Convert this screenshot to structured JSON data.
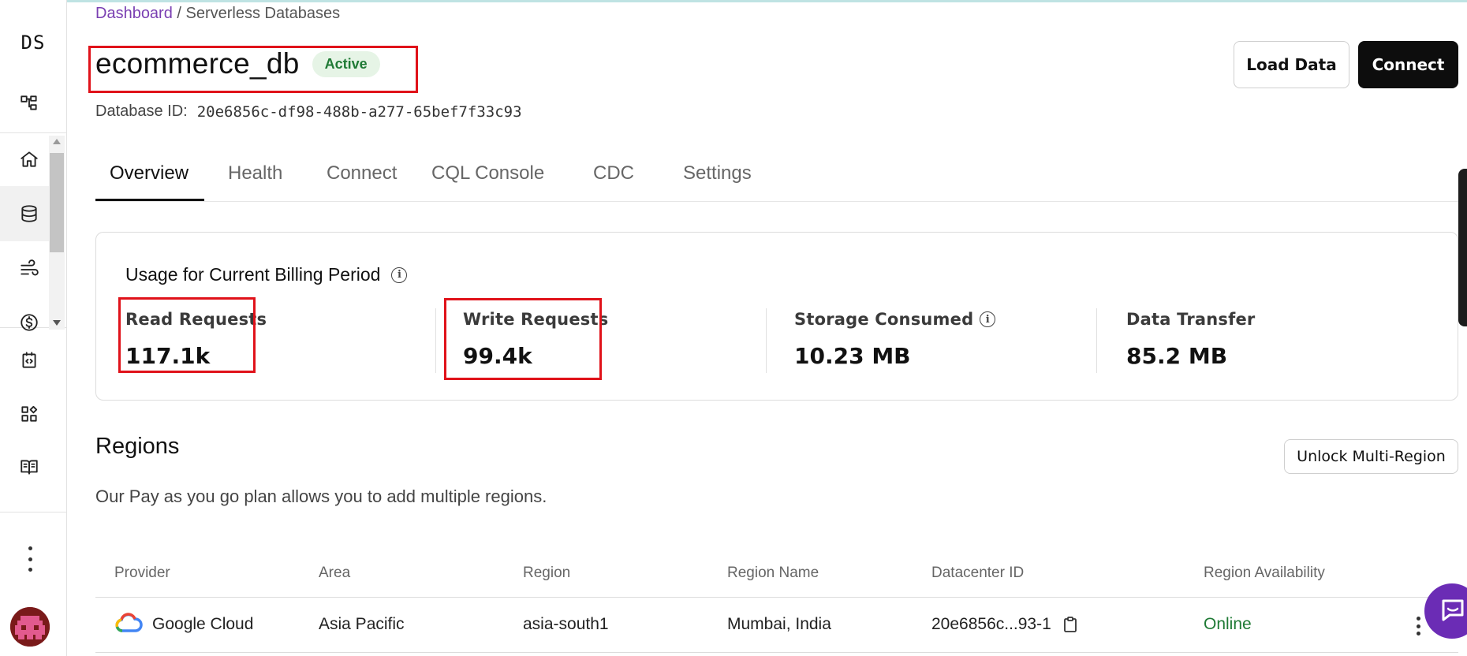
{
  "sidebar": {
    "logo": "DS",
    "items": [
      {
        "icon": "hierarchy-icon"
      },
      {
        "icon": "home-icon"
      },
      {
        "icon": "database-icon"
      },
      {
        "icon": "streaming-icon"
      },
      {
        "icon": "billing-icon"
      },
      {
        "icon": "code-icon"
      },
      {
        "icon": "integrations-icon"
      },
      {
        "icon": "docs-icon"
      }
    ],
    "more": "kebab-icon",
    "avatar": "avatar"
  },
  "breadcrumb": {
    "link": "Dashboard",
    "separator": " / ",
    "current": "Serverless Databases"
  },
  "database": {
    "name": "ecommerce_db",
    "status": "Active",
    "id_label": "Database ID:",
    "id_value": "20e6856c-df98-488b-a277-65bef7f33c93"
  },
  "actions": {
    "load_data": "Load Data",
    "connect": "Connect"
  },
  "tabs": [
    {
      "label": "Overview",
      "active": true
    },
    {
      "label": "Health"
    },
    {
      "label": "Connect"
    },
    {
      "label": "CQL Console"
    },
    {
      "label": "CDC"
    },
    {
      "label": "Settings"
    }
  ],
  "usage": {
    "title": "Usage for Current Billing Period",
    "stats": [
      {
        "label": "Read Requests",
        "value": "117.1k"
      },
      {
        "label": "Write Requests",
        "value": "99.4k"
      },
      {
        "label": "Storage Consumed",
        "value": "10.23 MB"
      },
      {
        "label": "Data Transfer",
        "value": "85.2 MB"
      }
    ]
  },
  "regions": {
    "title": "Regions",
    "description": "Our Pay as you go plan allows you to add multiple regions.",
    "unlock_button": "Unlock Multi-Region",
    "columns": [
      "Provider",
      "Area",
      "Region",
      "Region Name",
      "Datacenter ID",
      "Region Availability"
    ],
    "rows": [
      {
        "provider": "Google Cloud",
        "area": "Asia Pacific",
        "region": "asia-south1",
        "region_name": "Mumbai, India",
        "datacenter_id": "20e6856c...93-1",
        "availability": "Online"
      }
    ]
  },
  "colors": {
    "accent_link": "#7a3fb2",
    "status_green": "#1f7a35",
    "highlight_red": "#e0121a",
    "primary_button": "#0d0d0d",
    "chat_purple": "#6b2cb5"
  }
}
